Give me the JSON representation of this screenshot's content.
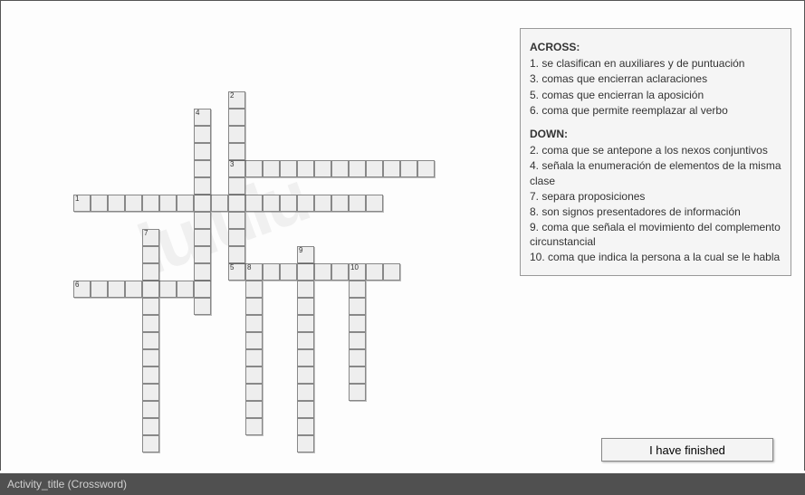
{
  "clues": {
    "across_heading": "ACROSS:",
    "down_heading": "DOWN:",
    "across": [
      {
        "n": "1",
        "text": "se clasifican en auxiliares y de puntuación"
      },
      {
        "n": "3",
        "text": "comas que encierran aclaraciones"
      },
      {
        "n": "5",
        "text": "comas que encierran la aposición"
      },
      {
        "n": "6",
        "text": "coma que permite reemplazar al verbo"
      }
    ],
    "down": [
      {
        "n": "2",
        "text": "coma que se antepone a los nexos conjuntivos"
      },
      {
        "n": "4",
        "text": "señala la enumeración de elementos de la misma clase"
      },
      {
        "n": "7",
        "text": "separa proposiciones"
      },
      {
        "n": "8",
        "text": "son signos presentadores de información"
      },
      {
        "n": "9",
        "text": "coma que señala el movimiento del complemento circunstancial"
      },
      {
        "n": "10",
        "text": "coma que indica la persona a la cual se le habla"
      }
    ]
  },
  "finish_label": "I have finished",
  "status_text": "Activity_title (Crossword)",
  "watermark": "lululu",
  "cell_size": 19,
  "entries": [
    {
      "num": "1",
      "dir": "A",
      "row": 7,
      "col": 1,
      "len": 18
    },
    {
      "num": "3",
      "dir": "A",
      "row": 5,
      "col": 10,
      "len": 12
    },
    {
      "num": "5",
      "dir": "A",
      "row": 11,
      "col": 10,
      "len": 10
    },
    {
      "num": "6",
      "dir": "A",
      "row": 12,
      "col": 1,
      "len": 8
    },
    {
      "num": "2",
      "dir": "D",
      "row": 1,
      "col": 10,
      "len": 10
    },
    {
      "num": "4",
      "dir": "D",
      "row": 2,
      "col": 8,
      "len": 12
    },
    {
      "num": "7",
      "dir": "D",
      "row": 9,
      "col": 5,
      "len": 13
    },
    {
      "num": "8",
      "dir": "D",
      "row": 11,
      "col": 11,
      "len": 10
    },
    {
      "num": "9",
      "dir": "D",
      "row": 10,
      "col": 14,
      "len": 12
    },
    {
      "num": "10",
      "dir": "D",
      "row": 11,
      "col": 17,
      "len": 8
    }
  ]
}
